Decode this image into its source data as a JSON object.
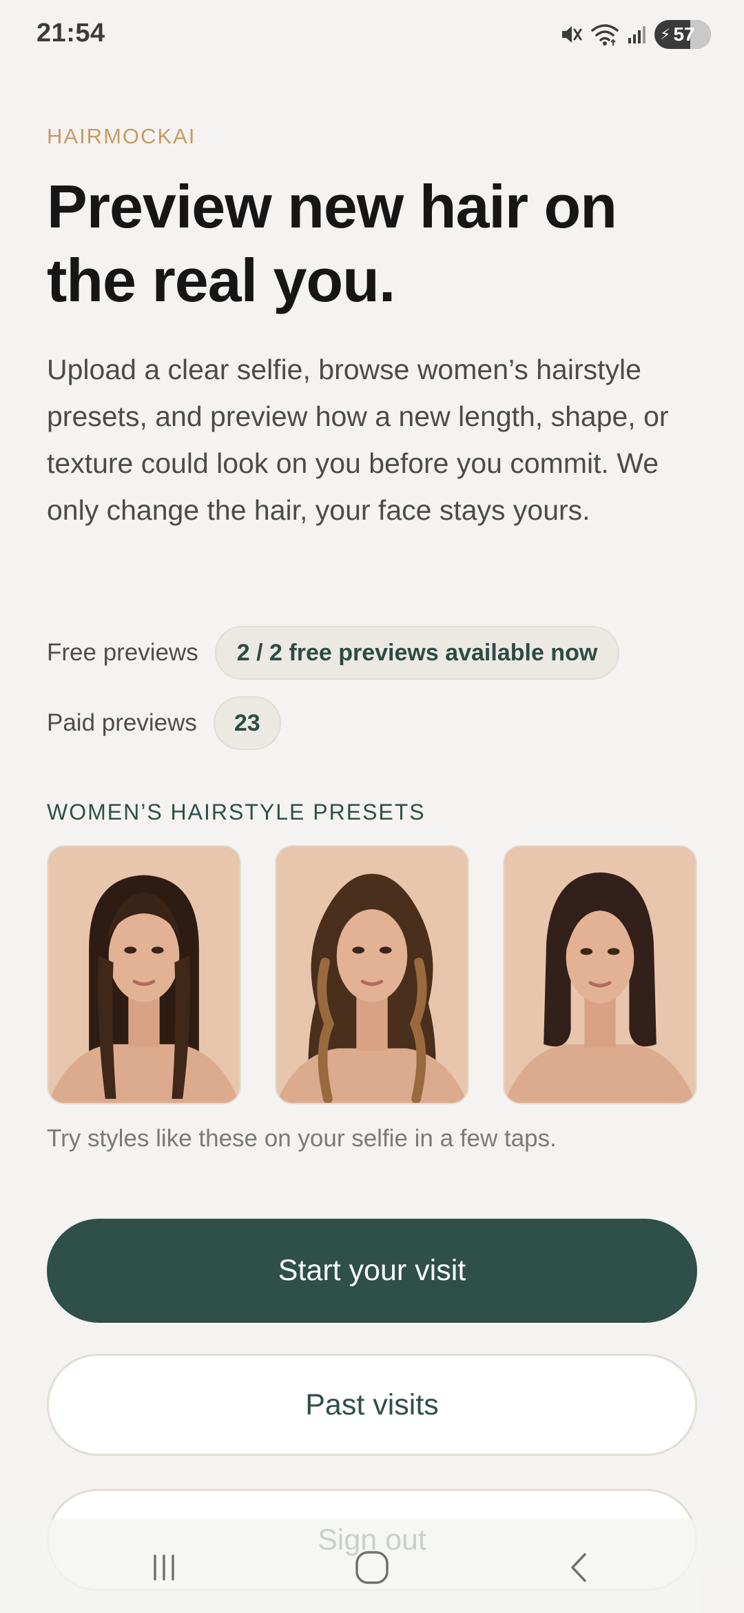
{
  "status_bar": {
    "time": "21:54",
    "battery_level": "57",
    "icons": [
      "mute-icon",
      "wifi-icon",
      "signal-icon",
      "battery-charging-icon"
    ]
  },
  "app": {
    "brand": "HAIRMOCKAI",
    "headline": "Preview new hair on the real you.",
    "intro": "Upload a clear selfie, browse women’s hairstyle presets, and preview how a new length, shape, or texture could look on you before you commit. We only change the hair, your face stays yours."
  },
  "previews": {
    "free_label": "Free previews",
    "free_value": "2 / 2 free previews available now",
    "paid_label": "Paid previews",
    "paid_value": "23"
  },
  "presets": {
    "title": "WOMEN’S HAIRSTYLE PRESETS",
    "items": [
      {
        "style": "long-layered-curtain-bangs",
        "hair_color": "#3a2418"
      },
      {
        "style": "long-wavy-balayage",
        "hair_color": "#5a3a22"
      },
      {
        "style": "shoulder-length-lob",
        "hair_color": "#33201a"
      }
    ],
    "caption": "Try styles like these on your selfie in a few taps."
  },
  "actions": {
    "start": "Start your visit",
    "past": "Past visits",
    "sign_out": "Sign out"
  },
  "colors": {
    "accent": "#2f4f49",
    "brand": "#c89a62",
    "background": "#f4f3f1"
  }
}
